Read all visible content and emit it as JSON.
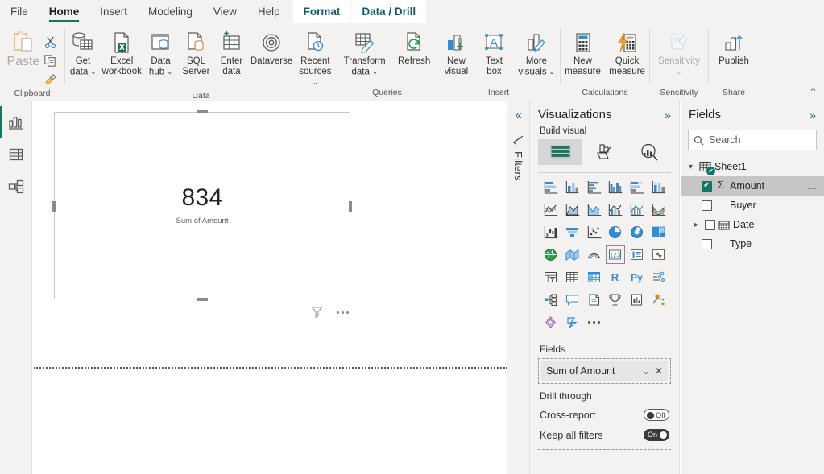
{
  "menubar": {
    "tabs": [
      {
        "label": "File",
        "state": "normal"
      },
      {
        "label": "Home",
        "state": "active"
      },
      {
        "label": "Insert",
        "state": "normal"
      },
      {
        "label": "Modeling",
        "state": "normal"
      },
      {
        "label": "View",
        "state": "normal"
      },
      {
        "label": "Help",
        "state": "normal"
      },
      {
        "label": "Format",
        "state": "contextual"
      },
      {
        "label": "Data / Drill",
        "state": "contextual"
      }
    ]
  },
  "ribbon": {
    "collapse_caret": "⌃",
    "groups": [
      {
        "name": "clipboard",
        "label": "Clipboard",
        "paste_label": "Paste",
        "small_buttons": [
          {
            "label": "Cut",
            "icon": "scissors-icon"
          },
          {
            "label": "Copy",
            "icon": "copy-icon"
          },
          {
            "label": "Format painter",
            "icon": "format-painter-icon"
          }
        ]
      },
      {
        "name": "data",
        "label": "Data",
        "buttons": [
          {
            "line1": "Get",
            "line2": "data",
            "caret": true,
            "icon": "get-data-icon"
          },
          {
            "line1": "Excel",
            "line2": "workbook",
            "caret": false,
            "icon": "excel-workbook-icon"
          },
          {
            "line1": "Data",
            "line2": "hub",
            "caret": true,
            "icon": "data-hub-icon"
          },
          {
            "line1": "SQL",
            "line2": "Server",
            "caret": false,
            "icon": "sql-server-icon"
          },
          {
            "line1": "Enter",
            "line2": "data",
            "caret": false,
            "icon": "enter-data-icon"
          },
          {
            "line1": "Dataverse",
            "line2": "",
            "caret": false,
            "icon": "dataverse-icon"
          },
          {
            "line1": "Recent",
            "line2": "sources",
            "caret": true,
            "icon": "recent-sources-icon"
          }
        ]
      },
      {
        "name": "queries",
        "label": "Queries",
        "buttons": [
          {
            "line1": "Transform",
            "line2": "data",
            "caret": true,
            "icon": "transform-data-icon"
          },
          {
            "line1": "Refresh",
            "line2": "",
            "caret": false,
            "icon": "refresh-icon"
          }
        ]
      },
      {
        "name": "insert",
        "label": "Insert",
        "buttons": [
          {
            "line1": "New",
            "line2": "visual",
            "caret": false,
            "icon": "new-visual-icon"
          },
          {
            "line1": "Text",
            "line2": "box",
            "caret": false,
            "icon": "text-box-icon"
          },
          {
            "line1": "More",
            "line2": "visuals",
            "caret": true,
            "icon": "more-visuals-icon"
          }
        ]
      },
      {
        "name": "calculations",
        "label": "Calculations",
        "buttons": [
          {
            "line1": "New",
            "line2": "measure",
            "caret": false,
            "icon": "new-measure-icon"
          },
          {
            "line1": "Quick",
            "line2": "measure",
            "caret": false,
            "icon": "quick-measure-icon"
          }
        ]
      },
      {
        "name": "sensitivity",
        "label": "Sensitivity",
        "buttons": [
          {
            "line1": "Sensitivity",
            "line2": "",
            "caret": true,
            "icon": "sensitivity-icon",
            "disabled": true
          }
        ]
      },
      {
        "name": "share",
        "label": "Share",
        "buttons": [
          {
            "line1": "Publish",
            "line2": "",
            "caret": false,
            "icon": "publish-icon"
          }
        ]
      }
    ]
  },
  "left_rail": {
    "items": [
      {
        "name": "report-view",
        "icon": "report-chart-icon",
        "active": true
      },
      {
        "name": "data-view",
        "icon": "table-grid-icon",
        "active": false
      },
      {
        "name": "model-view",
        "icon": "model-relationship-icon",
        "active": false
      }
    ]
  },
  "canvas": {
    "card_visual": {
      "value": "834",
      "label": "Sum of Amount",
      "filter_icon": "funnel-icon",
      "more_options_icon": "more-options-icon"
    }
  },
  "filters_pane": {
    "collapse_icon": "chevron-double-left-icon",
    "filter_icon": "filter-funnel-icon",
    "title": "Filters"
  },
  "visualizations": {
    "title": "Visualizations",
    "expand_icon": "chevron-double-right-icon",
    "build_visual_label": "Build visual",
    "build_tabs": [
      {
        "name": "build-visual-tab",
        "icon": "build-visual-icon",
        "selected": true
      },
      {
        "name": "format-visual-tab",
        "icon": "format-paint-roller-icon",
        "selected": false
      },
      {
        "name": "analytics-tab",
        "icon": "analytics-magnifier-icon",
        "selected": false
      }
    ],
    "visual_types": [
      {
        "name": "stacked-bar-chart",
        "selected": false
      },
      {
        "name": "stacked-column-chart",
        "selected": false
      },
      {
        "name": "clustered-bar-chart",
        "selected": false
      },
      {
        "name": "clustered-column-chart",
        "selected": false
      },
      {
        "name": "100-percent-stacked-bar-chart",
        "selected": false
      },
      {
        "name": "100-percent-stacked-column-chart",
        "selected": false
      },
      {
        "name": "line-chart",
        "selected": false
      },
      {
        "name": "area-chart",
        "selected": false
      },
      {
        "name": "stacked-area-chart",
        "selected": false
      },
      {
        "name": "line-and-stacked-column-chart",
        "selected": false
      },
      {
        "name": "line-and-clustered-column-chart",
        "selected": false
      },
      {
        "name": "ribbon-chart",
        "selected": false
      },
      {
        "name": "waterfall-chart",
        "selected": false
      },
      {
        "name": "funnel-chart",
        "selected": false
      },
      {
        "name": "scatter-chart",
        "selected": false
      },
      {
        "name": "pie-chart",
        "selected": false
      },
      {
        "name": "donut-chart",
        "selected": false
      },
      {
        "name": "treemap-chart",
        "selected": false
      },
      {
        "name": "map-visual",
        "selected": false
      },
      {
        "name": "filled-map-visual",
        "selected": false
      },
      {
        "name": "azure-map-visual",
        "selected": false
      },
      {
        "name": "card-visual",
        "selected": true
      },
      {
        "name": "multi-row-card-visual",
        "selected": false
      },
      {
        "name": "kpi-visual",
        "selected": false
      },
      {
        "name": "slicer-visual",
        "selected": false
      },
      {
        "name": "table-visual",
        "selected": false
      },
      {
        "name": "matrix-visual",
        "selected": false
      },
      {
        "name": "r-script-visual",
        "selected": false
      },
      {
        "name": "python-visual",
        "selected": false
      },
      {
        "name": "key-influencers-visual",
        "selected": false
      },
      {
        "name": "decomposition-tree-visual",
        "selected": false
      },
      {
        "name": "q-and-a-visual",
        "selected": false
      },
      {
        "name": "narrative-visual",
        "selected": false
      },
      {
        "name": "paginated-report-visual",
        "selected": false
      },
      {
        "name": "metrics-visual",
        "selected": false
      },
      {
        "name": "arcgis-maps-visual",
        "selected": false
      },
      {
        "name": "power-apps-visual",
        "selected": false
      },
      {
        "name": "power-automate-visual",
        "selected": false
      },
      {
        "name": "more-visuals-ellipsis",
        "selected": false
      }
    ],
    "fields_label": "Fields",
    "field_chip": {
      "label": "Sum of Amount",
      "dropdown_icon": "chevron-down-icon",
      "remove_icon": "close-icon"
    },
    "drill_through_label": "Drill through",
    "toggles": [
      {
        "label": "Cross-report",
        "state_text": "Off",
        "on": false
      },
      {
        "label": "Keep all filters",
        "state_text": "On",
        "on": true
      }
    ]
  },
  "fields": {
    "title": "Fields",
    "expand_icon": "chevron-double-right-icon",
    "search": {
      "placeholder": "Search",
      "value": "",
      "icon": "search-icon"
    },
    "tree": {
      "table_name": "Sheet1",
      "table_icon": "table-icon",
      "expanded": true,
      "items": [
        {
          "label": "Amount",
          "checked": true,
          "selected": true,
          "icon": "sigma-measure-icon",
          "expandable": false,
          "has_more": true
        },
        {
          "label": "Buyer",
          "checked": false,
          "selected": false,
          "icon": "",
          "expandable": false,
          "has_more": false
        },
        {
          "label": "Date",
          "checked": false,
          "selected": false,
          "icon": "calendar-icon",
          "expandable": true,
          "has_more": false
        },
        {
          "label": "Type",
          "checked": false,
          "selected": false,
          "icon": "",
          "expandable": false,
          "has_more": false
        }
      ]
    }
  },
  "colors": {
    "accent_green": "#117865",
    "contextual_tab_text": "#0b5c70",
    "ribbon_bg": "#f3f2f1",
    "blue_icon": "#2e8fd6"
  }
}
